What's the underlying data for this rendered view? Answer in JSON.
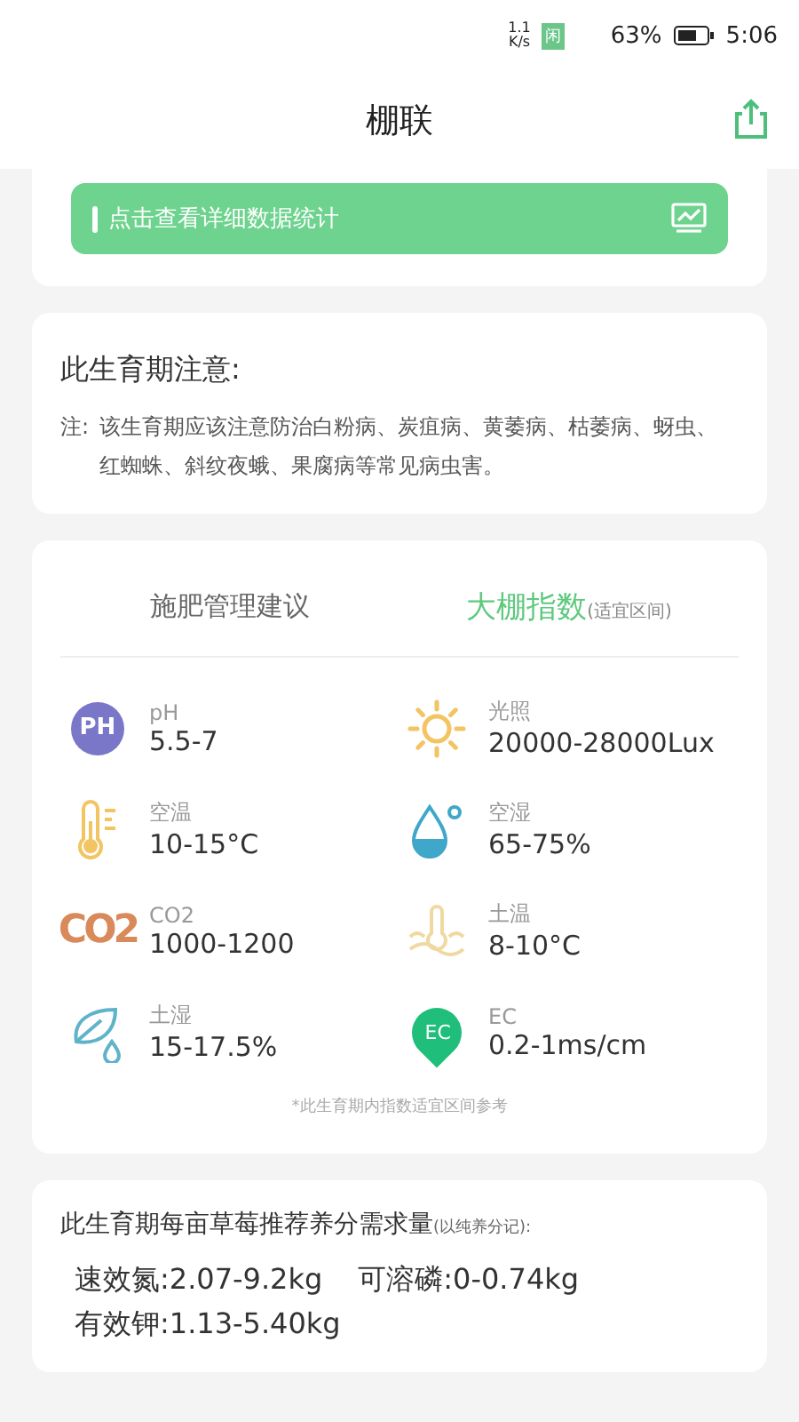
{
  "status_bar": {
    "net_speed": "1.1",
    "net_unit": "K/s",
    "badge": "闲",
    "battery": "63%",
    "time": "5:06"
  },
  "header": {
    "title": "棚联"
  },
  "stats_banner": {
    "label": "点击查看详细数据统计"
  },
  "notice": {
    "title": "此生育期注意:",
    "prefix": "注:",
    "text": "该生育期应该注意防治白粉病、炭疽病、黄萎病、枯萎病、蚜虫、红蜘蛛、斜纹夜蛾、果腐病等常见病虫害。"
  },
  "tabs": [
    {
      "label": "施肥管理建议",
      "selected": false
    },
    {
      "label": "大棚指数",
      "note": "(适宜区间)",
      "selected": true
    }
  ],
  "indices": [
    {
      "kind": "ph",
      "icon_text": "PH",
      "name": "pH",
      "value": "5.5-7"
    },
    {
      "kind": "sun",
      "name": "光照",
      "value": "20000-28000Lux"
    },
    {
      "kind": "thermo",
      "name": "空温",
      "value": "10-15°C"
    },
    {
      "kind": "drop",
      "name": "空湿",
      "value": "65-75%"
    },
    {
      "kind": "co2",
      "icon_text": "CO2",
      "name": "CO2",
      "value": "1000-1200"
    },
    {
      "kind": "soil_temp",
      "name": "土温",
      "value": "8-10°C"
    },
    {
      "kind": "leaf",
      "name": "土湿",
      "value": "15-17.5%"
    },
    {
      "kind": "ec",
      "icon_text": "EC",
      "name": "EC",
      "value": "0.2-1ms/cm"
    }
  ],
  "indices_footnote": "*此生育期内指数适宜区间参考",
  "nutrients": {
    "title": "此生育期每亩草莓推荐养分需求量",
    "note": "(以纯养分记):",
    "items": [
      "速效氮:2.07-9.2kg",
      "可溶磷:0-0.74kg",
      "有效钾:1.13-5.40kg"
    ]
  }
}
